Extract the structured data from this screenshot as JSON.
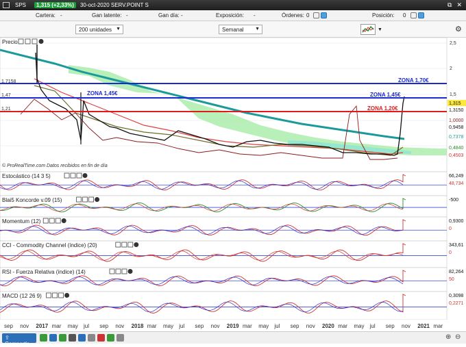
{
  "titlebar": {
    "symbol": "SPS",
    "change": "1,315 (+2,33%)",
    "datetime": "30-oct-2020  SERV.POINT S"
  },
  "positions": {
    "cartera_label": "Cartera:",
    "cartera_value": "-",
    "gan_latente_label": "Gan latente:",
    "gan_latente_value": "-",
    "gan_dia_label": "Gan día:",
    "gan_dia_value": "-",
    "exposicion_label": "Exposición:",
    "exposicion_value": "-",
    "ordenes_label": "Órdenes:",
    "ordenes_value": "0",
    "posicion_label": "Posición:",
    "posicion_value": "0"
  },
  "toolbar": {
    "units": "200 unidades",
    "period": "Semanal"
  },
  "chart": {
    "price_label": "Precio",
    "watermark": "© ProRealTime.com  Datos recibidos en fin de día",
    "zones": [
      "ZONA 1,70€",
      "ZONA 1,45€",
      "ZONA 1,45€",
      "ZONA 1,20€"
    ],
    "left_levels": [
      "1,7158",
      "1,47",
      "1,21"
    ],
    "right_axis": [
      "2,5",
      "2",
      "1,5",
      "1,315",
      "1,3150",
      "1,0000",
      "0,9458",
      "0,7378",
      "0,4840",
      "0,4503"
    ],
    "x_axis": [
      "sep",
      "nov",
      "2017",
      "mar",
      "may",
      "jul",
      "sep",
      "nov",
      "2018",
      "mar",
      "may",
      "jul",
      "sep",
      "nov",
      "2019",
      "mar",
      "may",
      "jul",
      "sep",
      "nov",
      "2020",
      "mar",
      "may",
      "jul",
      "sep",
      "nov",
      "2021",
      "mar"
    ],
    "indicators": [
      {
        "name": "Estocástico (14 3 5)",
        "values": [
          "66,249",
          "48,734"
        ]
      },
      {
        "name": "Blai5 Koncorde v.09 (15)",
        "values": [
          "-500"
        ]
      },
      {
        "name": "Momentum (12)",
        "values": [
          "0,9300",
          "0"
        ]
      },
      {
        "name": "CCI - Commodity Channel (índice) (20)",
        "values": [
          "343,61",
          "0"
        ]
      },
      {
        "name": "RSI - Fuerza Relativa (índice) (14)",
        "values": [
          "82,264",
          "50"
        ]
      },
      {
        "name": "MACD (12 26 9)",
        "values": [
          "0,3098",
          "0,2271"
        ]
      }
    ]
  },
  "footer": {
    "share": "Compartir"
  }
}
